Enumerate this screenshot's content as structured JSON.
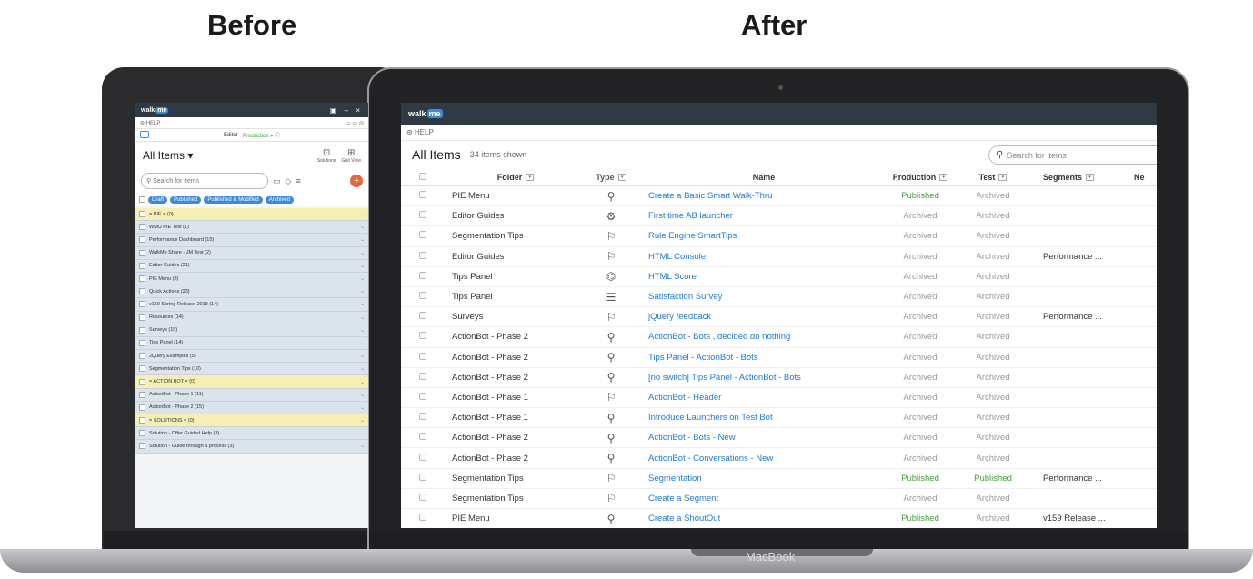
{
  "headings": {
    "before": "Before",
    "after": "After"
  },
  "laptop_label": "MacBook",
  "before": {
    "logo": "walk",
    "logo_me": "me",
    "window_controls": "▣ – ×",
    "help": "HELP",
    "editor_label": "Editor -",
    "editor_env": "Production",
    "title": "All Items",
    "solutions": "Solutions",
    "grid_view": "Grid View",
    "search_placeholder": "Search for items",
    "chips": [
      "Draft",
      "Published",
      "Published & Modified",
      "Archived"
    ],
    "rows": [
      {
        "label": "= PIE = (0)",
        "group": true
      },
      {
        "label": "WMU PIE Test (1)",
        "group": false
      },
      {
        "label": "Performance Dashboard (15)",
        "group": false
      },
      {
        "label": "WalkMe Share - JM Test (2)",
        "group": false
      },
      {
        "label": "Editor Guides (21)",
        "group": false
      },
      {
        "label": "PIE Menu (8)",
        "group": false
      },
      {
        "label": "Quick Actions (23)",
        "group": false
      },
      {
        "label": "v159 Spring Release 2019 (14)",
        "group": false
      },
      {
        "label": "Resources (14)",
        "group": false
      },
      {
        "label": "Surveys (15)",
        "group": false
      },
      {
        "label": "Tips Panel (14)",
        "group": false
      },
      {
        "label": "JQuery Examples (5)",
        "group": false
      },
      {
        "label": "Segmentation Tips (10)",
        "group": false
      },
      {
        "label": "= ACTION BOT = (0)",
        "group": true
      },
      {
        "label": "ActionBot - Phase 1 (11)",
        "group": false
      },
      {
        "label": "ActionBot - Phase 2 (15)",
        "group": false
      },
      {
        "label": "= SOLUTIONS = (0)",
        "group": true
      },
      {
        "label": "Solution - Offer Guided Help (3)",
        "group": false
      },
      {
        "label": "Solution - Guide through a process (3)",
        "group": false
      }
    ]
  },
  "after": {
    "logo": "walk",
    "logo_me": "me",
    "help": "HELP",
    "title": "All Items",
    "count": "34 items shown",
    "search_placeholder": "Search for items",
    "columns": {
      "folder": "Folder",
      "type": "Type",
      "name": "Name",
      "production": "Production",
      "test": "Test",
      "segments": "Segments",
      "ne": "Ne"
    },
    "rows": [
      {
        "folder": "PIE Menu",
        "icon": "flow-icon",
        "glyph": "⚲",
        "name": "Create a Basic Smart Walk-Thru",
        "production": "Published",
        "test": "Archived",
        "segments": ""
      },
      {
        "folder": "Editor Guides",
        "icon": "launcher-icon",
        "glyph": "⚙",
        "name": "First time AB launcher",
        "production": "Archived",
        "test": "Archived",
        "segments": ""
      },
      {
        "folder": "Segmentation Tips",
        "icon": "smarttip-icon",
        "glyph": "⚐",
        "name": "Rule Engine SmartTips",
        "production": "Archived",
        "test": "Archived",
        "segments": ""
      },
      {
        "folder": "Editor Guides",
        "icon": "smarttip-icon",
        "glyph": "⚐",
        "name": "HTML Console",
        "production": "Archived",
        "test": "Archived",
        "segments": "Performance ..."
      },
      {
        "folder": "Tips Panel",
        "icon": "shoutout-icon",
        "glyph": "⌬",
        "name": "HTML Score",
        "production": "Archived",
        "test": "Archived",
        "segments": ""
      },
      {
        "folder": "Tips Panel",
        "icon": "survey-icon",
        "glyph": "☰",
        "name": "Satisfaction Survey",
        "production": "Archived",
        "test": "Archived",
        "segments": ""
      },
      {
        "folder": "Surveys",
        "icon": "smarttip-icon",
        "glyph": "⚐",
        "name": "jQuery feedback",
        "production": "Archived",
        "test": "Archived",
        "segments": "Performance ..."
      },
      {
        "folder": "ActionBot - Phase 2",
        "icon": "flow-icon",
        "glyph": "⚲",
        "name": "ActionBot - Bots , decided do nothing",
        "production": "Archived",
        "test": "Archived",
        "segments": ""
      },
      {
        "folder": "ActionBot - Phase 2",
        "icon": "flow-icon",
        "glyph": "⚲",
        "name": "Tips Panel - ActionBot - Bots",
        "production": "Archived",
        "test": "Archived",
        "segments": ""
      },
      {
        "folder": "ActionBot - Phase 2",
        "icon": "flow-icon",
        "glyph": "⚲",
        "name": "[no switch] Tips Panel - ActionBot - Bots",
        "production": "Archived",
        "test": "Archived",
        "segments": ""
      },
      {
        "folder": "ActionBot - Phase 1",
        "icon": "smarttip-icon",
        "glyph": "⚐",
        "name": "ActionBot - Header",
        "production": "Archived",
        "test": "Archived",
        "segments": ""
      },
      {
        "folder": "ActionBot - Phase 1",
        "icon": "flow-icon",
        "glyph": "⚲",
        "name": "Introduce Launchers on Test Bot",
        "production": "Archived",
        "test": "Archived",
        "segments": ""
      },
      {
        "folder": "ActionBot - Phase 2",
        "icon": "flow-icon",
        "glyph": "⚲",
        "name": "ActionBot - Bots - New",
        "production": "Archived",
        "test": "Archived",
        "segments": ""
      },
      {
        "folder": "ActionBot - Phase 2",
        "icon": "flow-icon",
        "glyph": "⚲",
        "name": "ActionBot - Conversations - New",
        "production": "Archived",
        "test": "Archived",
        "segments": ""
      },
      {
        "folder": "Segmentation Tips",
        "icon": "smarttip-icon",
        "glyph": "⚐",
        "name": "Segmentation",
        "production": "Published",
        "test": "Published",
        "segments": "Performance ..."
      },
      {
        "folder": "Segmentation Tips",
        "icon": "smarttip-icon",
        "glyph": "⚐",
        "name": "Create a Segment",
        "production": "Archived",
        "test": "Archived",
        "segments": ""
      },
      {
        "folder": "PIE Menu",
        "icon": "flow-icon",
        "glyph": "⚲",
        "name": "Create a ShoutOut",
        "production": "Published",
        "test": "Archived",
        "segments": "v159 Release ..."
      }
    ]
  }
}
